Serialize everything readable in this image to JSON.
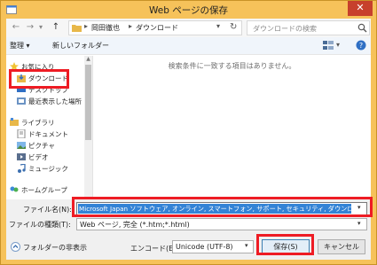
{
  "window": {
    "title": "Web ページの保存",
    "close_glyph": "✕"
  },
  "address": {
    "crumbs": [
      "岡田徹也",
      "ダウンロード"
    ],
    "separator": "▸",
    "back_glyph": "←",
    "forward_glyph": "→",
    "history_glyph": "▾",
    "up_glyph": "↑",
    "dropdown_glyph": "▾",
    "refresh_glyph": "↻",
    "search_placeholder": "ダウンロードの検索"
  },
  "toolbar": {
    "organize": "整理 ▾",
    "new_folder": "新しいフォルダー",
    "view_dropdown": "▾"
  },
  "nav": {
    "items": [
      {
        "label": "お気に入り",
        "icon": "star-icon"
      },
      {
        "label": "ダウンロード",
        "icon": "download-folder-icon"
      },
      {
        "label": "デスクトップ",
        "icon": "desktop-icon"
      },
      {
        "label": "最近表示した場所",
        "icon": "recent-places-icon"
      },
      {
        "label": "ライブラリ",
        "icon": "library-icon"
      },
      {
        "label": "ドキュメント",
        "icon": "documents-icon"
      },
      {
        "label": "ピクチャ",
        "icon": "pictures-icon"
      },
      {
        "label": "ビデオ",
        "icon": "videos-icon"
      },
      {
        "label": "ミュージック",
        "icon": "music-icon"
      },
      {
        "label": "ホームグループ",
        "icon": "homegroup-icon"
      }
    ],
    "scroll_up": "▲",
    "scroll_down": "▼"
  },
  "main": {
    "empty_message": "検索条件に一致する項目はありません。"
  },
  "form": {
    "filename_label": "ファイル名(N):",
    "filename_value": "Microsoft Japan ソフトウェア, オンライン, スマートフォン, サポート, セキュリティ, ダウンロード, アップデート",
    "filetype_label": "ファイルの種類(T):",
    "filetype_value": "Web ページ, 完全 (*.htm;*.html)",
    "dropdown_glyph": "▾",
    "hide_folders": "フォルダーの非表示",
    "encoding_label": "エンコード(E):",
    "encoding_value": "Unicode (UTF-8)",
    "save_button": "保存(S)",
    "cancel_button": "キャンセル"
  },
  "colors": {
    "frame": "#f6c25a",
    "highlight": "#ee1c24",
    "selection": "#3383d6"
  }
}
